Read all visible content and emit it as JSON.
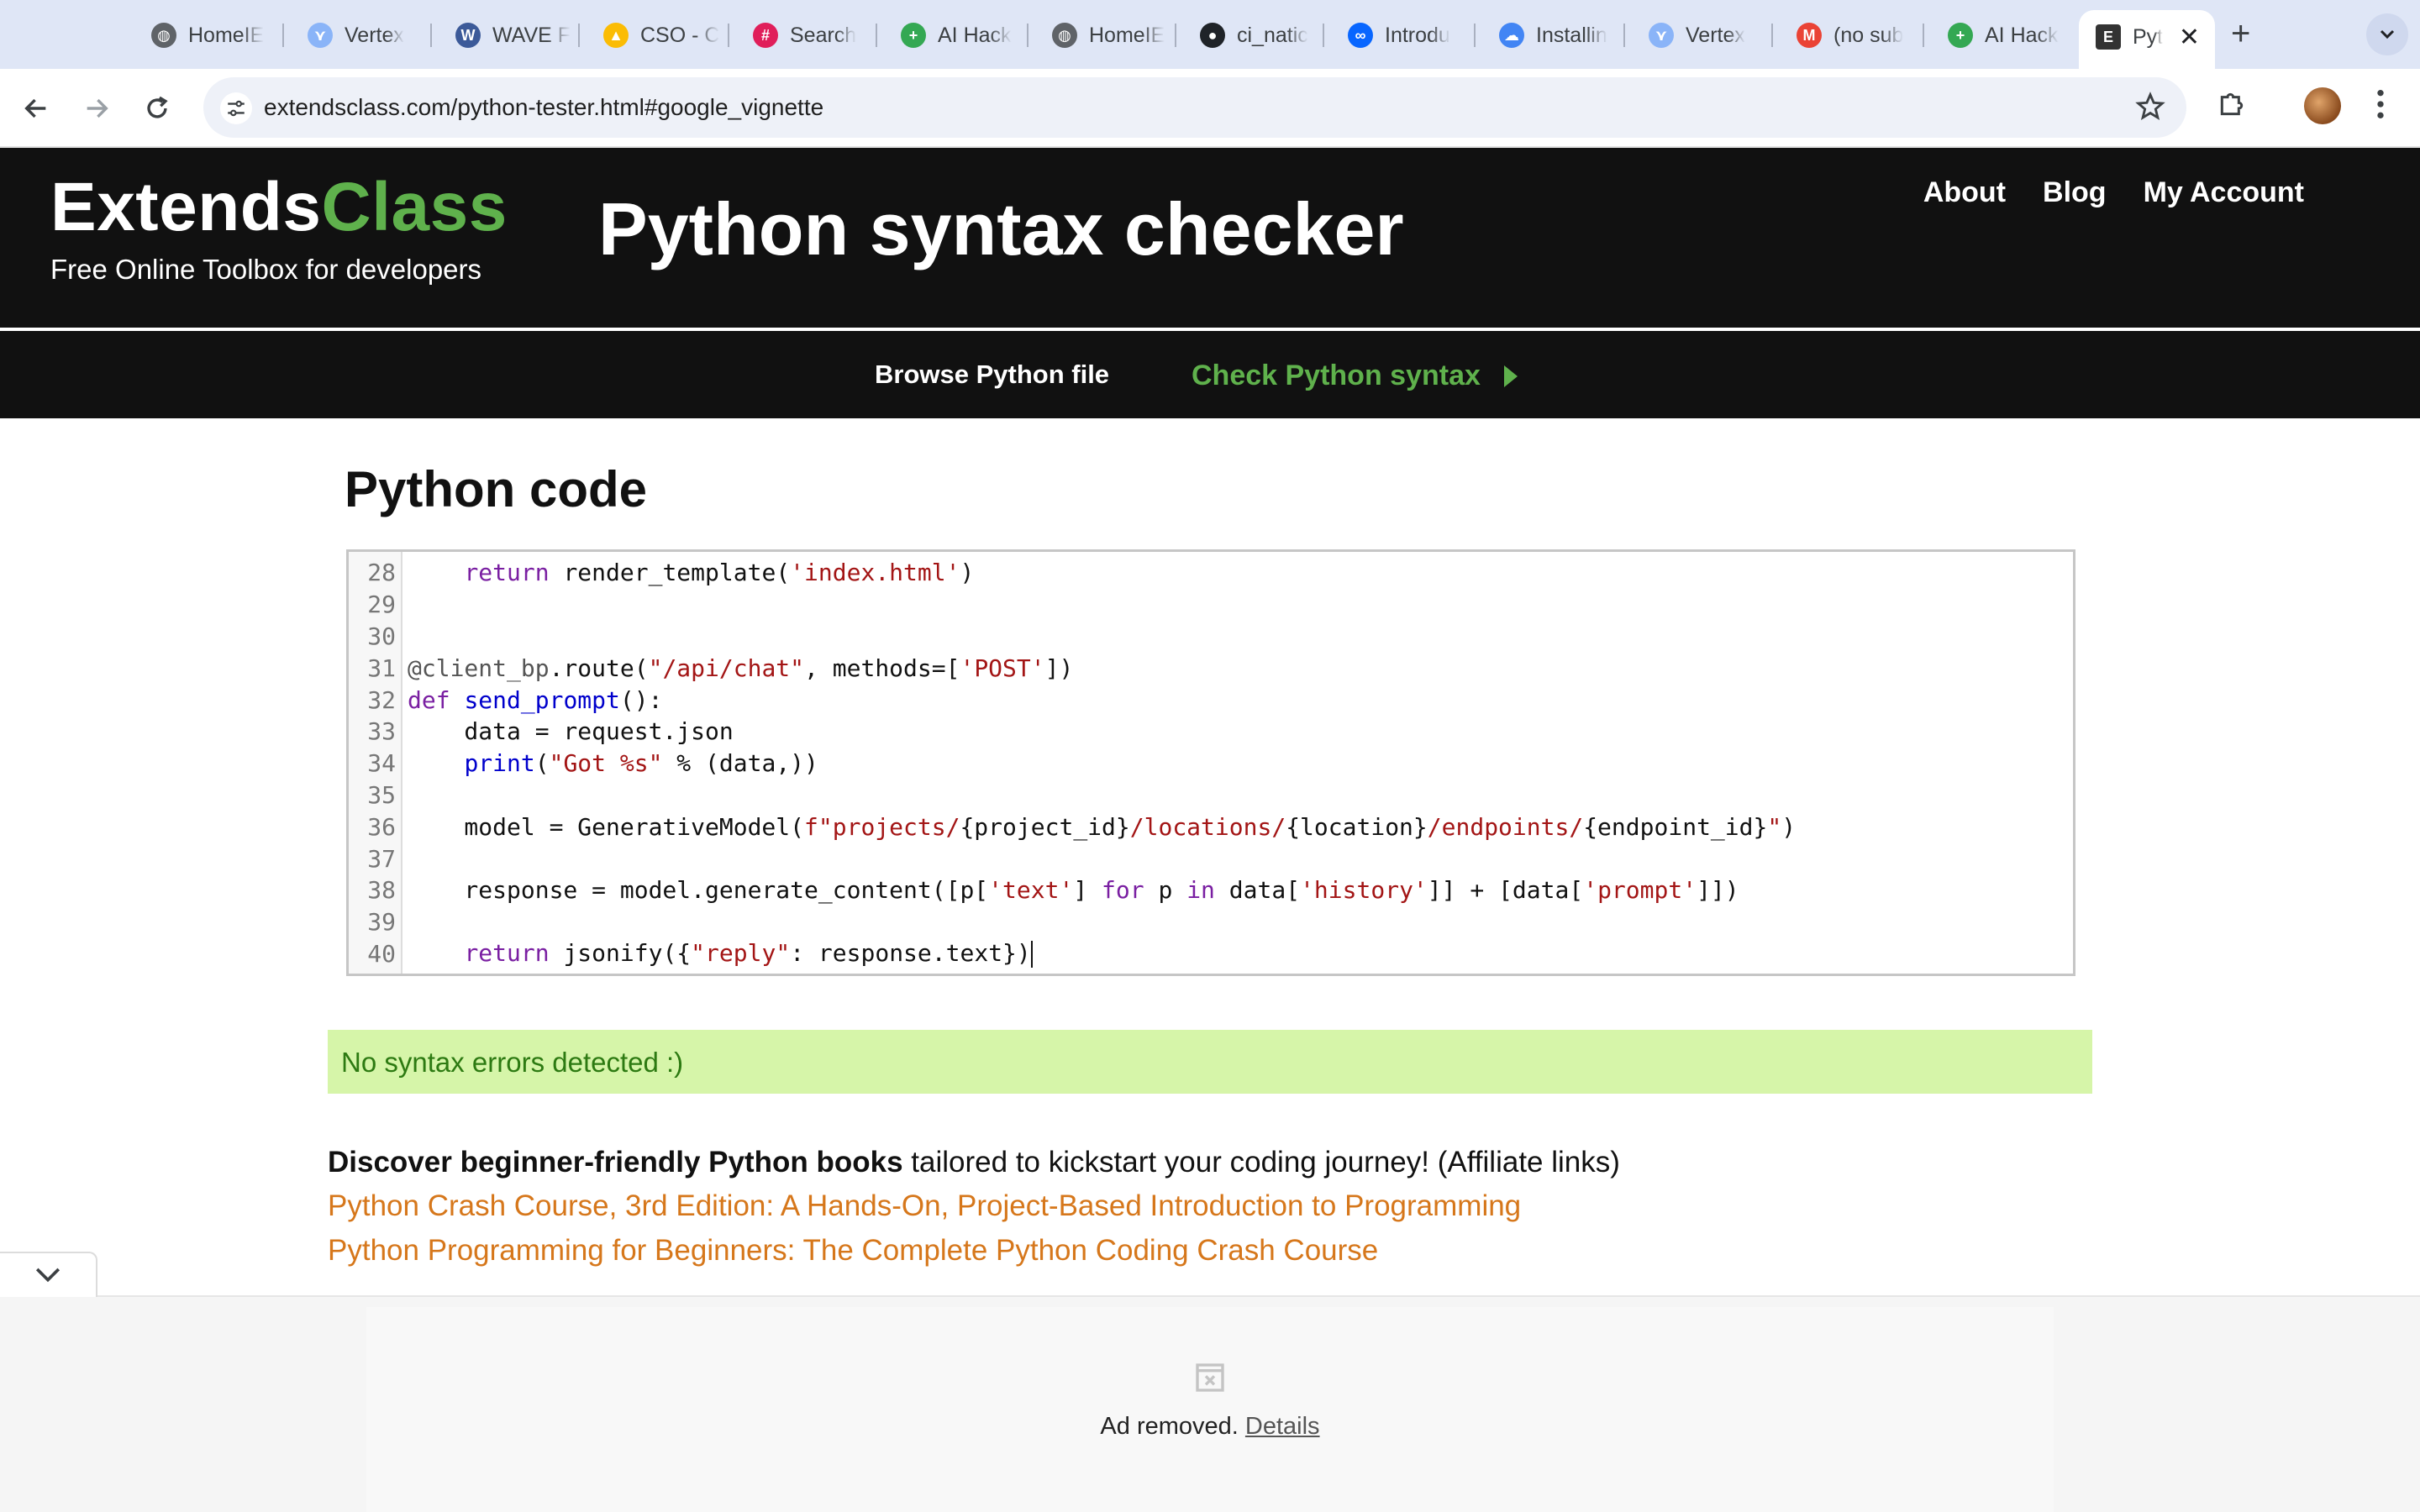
{
  "browser": {
    "tabs": [
      {
        "title": "HomeIE",
        "icon": "globe-icon",
        "color": "#5f6368"
      },
      {
        "title": "Vertex",
        "icon": "vertex-icon",
        "color": "#8ab4f8"
      },
      {
        "title": "WAVE F",
        "icon": "wave-icon",
        "color": "#3c5a99"
      },
      {
        "title": "CSO - C",
        "icon": "drive-icon",
        "color": "#fbbc04"
      },
      {
        "title": "Search",
        "icon": "slack-icon",
        "color": "#e01e5a"
      },
      {
        "title": "AI Hack",
        "icon": "sheets-icon",
        "color": "#34a853"
      },
      {
        "title": "HomeIE",
        "icon": "globe-icon",
        "color": "#5f6368"
      },
      {
        "title": "ci_natic",
        "icon": "github-icon",
        "color": "#1f2328"
      },
      {
        "title": "Introdu",
        "icon": "meta-icon",
        "color": "#0866ff"
      },
      {
        "title": "Installin",
        "icon": "gcloud-icon",
        "color": "#4285f4"
      },
      {
        "title": "Vertex",
        "icon": "vertex-icon",
        "color": "#8ab4f8"
      },
      {
        "title": "(no sub",
        "icon": "gmail-icon",
        "color": "#ea4335"
      },
      {
        "title": "AI Hack",
        "icon": "sheets-icon",
        "color": "#34a853"
      }
    ],
    "active_tab": {
      "title": "Pyt",
      "icon": "extendsclass-icon",
      "close": "✕"
    },
    "new_tab": "+",
    "url": {
      "host": "extendsclass.com",
      "path": "/python-tester.html#google_vignette"
    }
  },
  "site": {
    "logo_main": "Extends",
    "logo_accent": "Class",
    "tagline": "Free Online Toolbox for developers",
    "title": "Python syntax checker",
    "nav": [
      "About",
      "Blog",
      "My Account"
    ],
    "subnav_browse": "Browse Python file",
    "subnav_check": "Check Python syntax",
    "accent_color": "#5fb14c"
  },
  "main": {
    "section_title": "Python code",
    "code_lines": [
      {
        "n": "28",
        "code": "    return render_template('index.html')"
      },
      {
        "n": "29",
        "code": ""
      },
      {
        "n": "30",
        "code": ""
      },
      {
        "n": "31",
        "code": "@client_bp.route(\"/api/chat\", methods=['POST'])"
      },
      {
        "n": "32",
        "code": "def send_prompt():"
      },
      {
        "n": "33",
        "code": "    data = request.json"
      },
      {
        "n": "34",
        "code": "    print(\"Got %s\" % (data,))"
      },
      {
        "n": "35",
        "code": ""
      },
      {
        "n": "36",
        "code": "    model = GenerativeModel(f\"projects/{project_id}/locations/{location}/endpoints/{endpoint_id}\")"
      },
      {
        "n": "37",
        "code": ""
      },
      {
        "n": "38",
        "code": "    response = model.generate_content([p['text'] for p in data['history']] + [data['prompt']])"
      },
      {
        "n": "39",
        "code": ""
      },
      {
        "n": "40",
        "code": "    return jsonify({\"reply\": response.text})"
      }
    ],
    "result": "No syntax errors detected :)",
    "books_intro_bold": "Discover beginner-friendly Python books",
    "books_intro_rest": " tailored to kickstart your coding journey! (Affiliate links)",
    "books": [
      "Python Crash Course, 3rd Edition: A Hands-On, Project-Based Introduction to Programming",
      "Python Programming for Beginners: The Complete Python Coding Crash Course"
    ]
  },
  "ad": {
    "text": "Ad removed.",
    "details": "Details"
  }
}
